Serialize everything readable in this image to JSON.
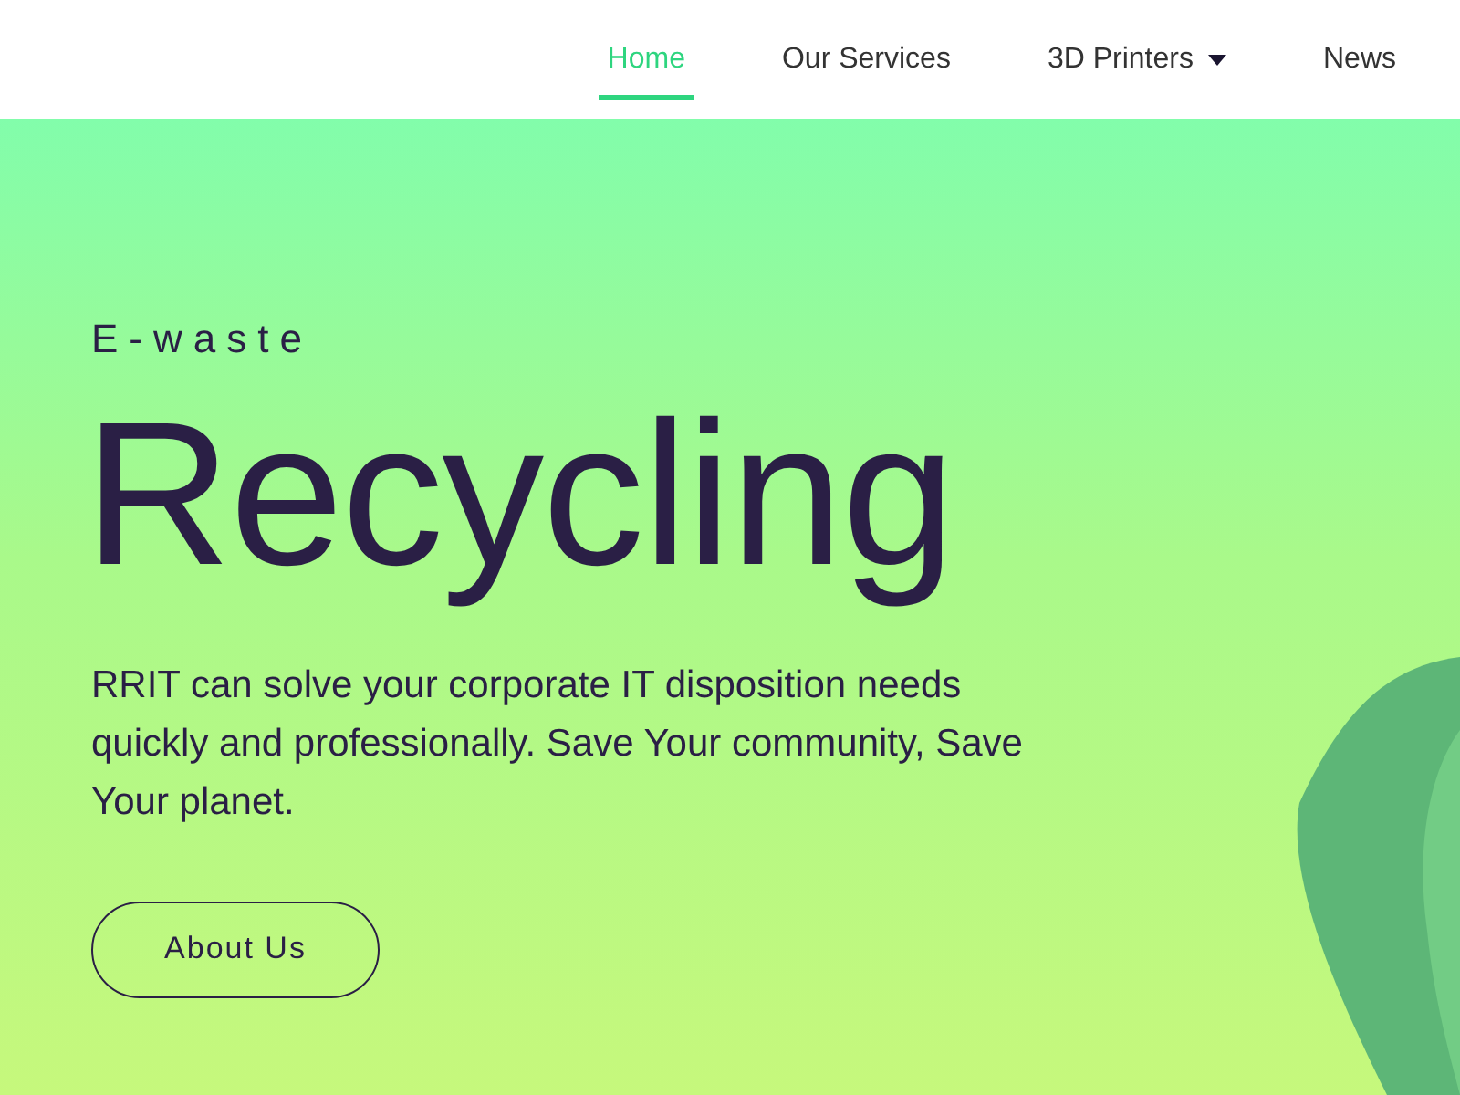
{
  "nav": [
    {
      "label": "Home",
      "selected": true,
      "dropdown": false
    },
    {
      "label": "Our Services",
      "selected": false,
      "dropdown": false
    },
    {
      "label": "3D Printers",
      "selected": false,
      "dropdown": true
    },
    {
      "label": "News",
      "selected": false,
      "dropdown": false
    }
  ],
  "hero": {
    "eyebrow": "E-waste",
    "title": "Recycling",
    "text": "RRIT can solve your corporate IT disposition needs quickly and professionally. Save Your community, Save Your planet.",
    "button": "About Us"
  }
}
